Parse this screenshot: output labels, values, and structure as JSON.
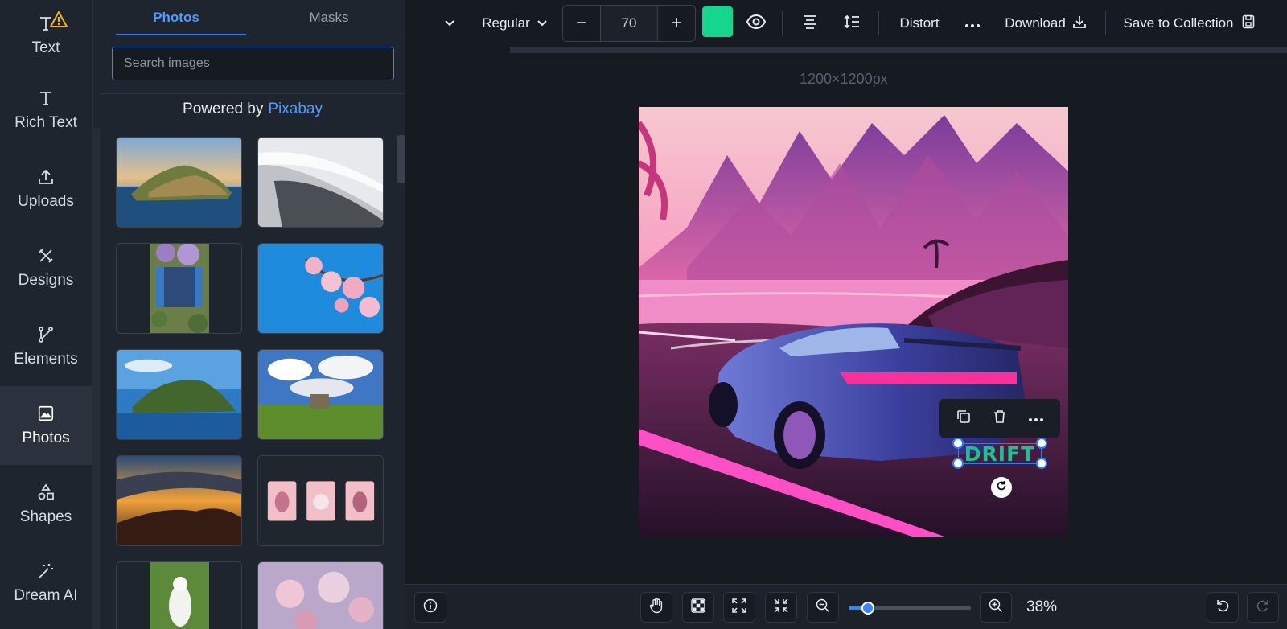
{
  "rail": {
    "items": [
      {
        "label": "Text",
        "icon": "text-icon"
      },
      {
        "label": "Rich Text",
        "icon": "rich-text-icon"
      },
      {
        "label": "Uploads",
        "icon": "upload-icon"
      },
      {
        "label": "Designs",
        "icon": "designs-icon"
      },
      {
        "label": "Elements",
        "icon": "elements-icon"
      },
      {
        "label": "Photos",
        "icon": "image-icon"
      },
      {
        "label": "Shapes",
        "icon": "shapes-icon"
      },
      {
        "label": "Dream AI",
        "icon": "magic-wand-icon"
      }
    ],
    "active": "Photos",
    "warning_icon": "warning-icon"
  },
  "panel": {
    "tabs": [
      {
        "label": "Photos"
      },
      {
        "label": "Masks"
      }
    ],
    "search_placeholder": "Search images",
    "powered_prefix": "Powered by",
    "powered_link": "Pixabay"
  },
  "toolbar": {
    "font_weight": "Regular",
    "font_size": "70",
    "text_color": "#16d68e",
    "distort_label": "Distort",
    "download_label": "Download",
    "save_label": "Save to Collection"
  },
  "canvas": {
    "dimensions": "1200×1200px",
    "selected_text": "DRIFT"
  },
  "zoom": {
    "value": "38%",
    "level_fraction": 0.16
  },
  "colors": {
    "accent": "#2e7df6",
    "link": "#4c9bff",
    "text_green": "#16c48f"
  }
}
